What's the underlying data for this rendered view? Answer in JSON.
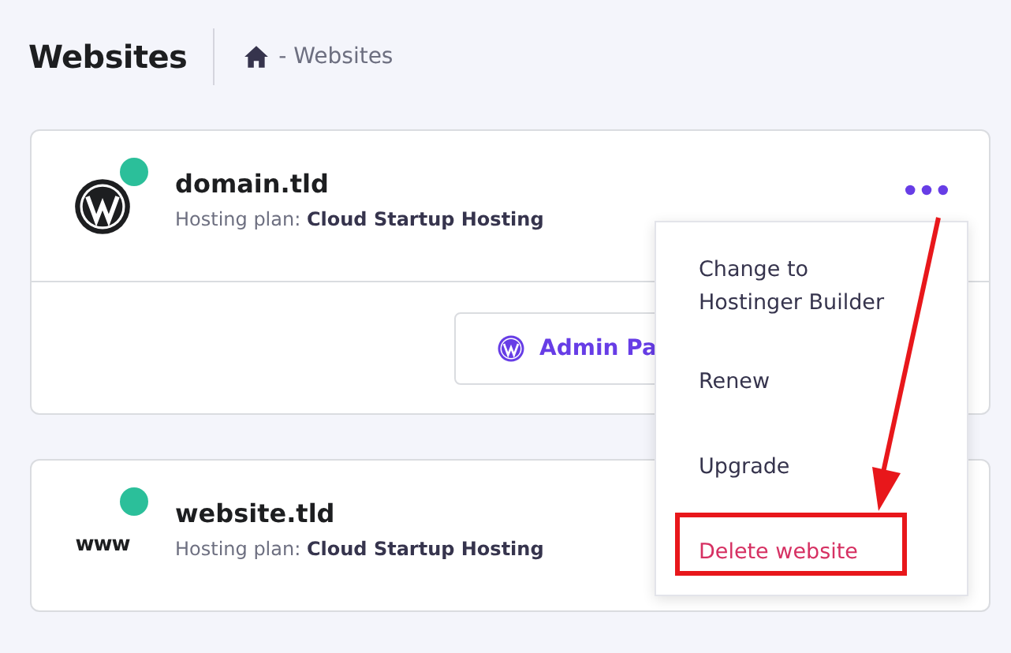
{
  "header": {
    "title": "Websites",
    "breadcrumb": "- Websites"
  },
  "websites": [
    {
      "domain": "domain.tld",
      "plan": "Hosting plan: **Cloud Startup Hosting**",
      "logo": {
        "kind": "wordpress"
      },
      "online": true,
      "action_button": "Admin Pa"
    },
    {
      "domain": "website.tld",
      "plan": "Hosting plan: **Cloud Startup Hosting**",
      "logo": {
        "kind": "text",
        "text": "www"
      },
      "online": true
    }
  ],
  "menu": {
    "items": [
      {
        "label": "Change to Hostinger Builder",
        "kind": "normal",
        "highlighted": false
      },
      {
        "label": "Renew",
        "kind": "normal",
        "highlighted": false
      },
      {
        "label": "Upgrade",
        "kind": "normal",
        "highlighted": false
      },
      {
        "label": "Delete website",
        "kind": "danger",
        "highlighted": true
      }
    ]
  }
}
